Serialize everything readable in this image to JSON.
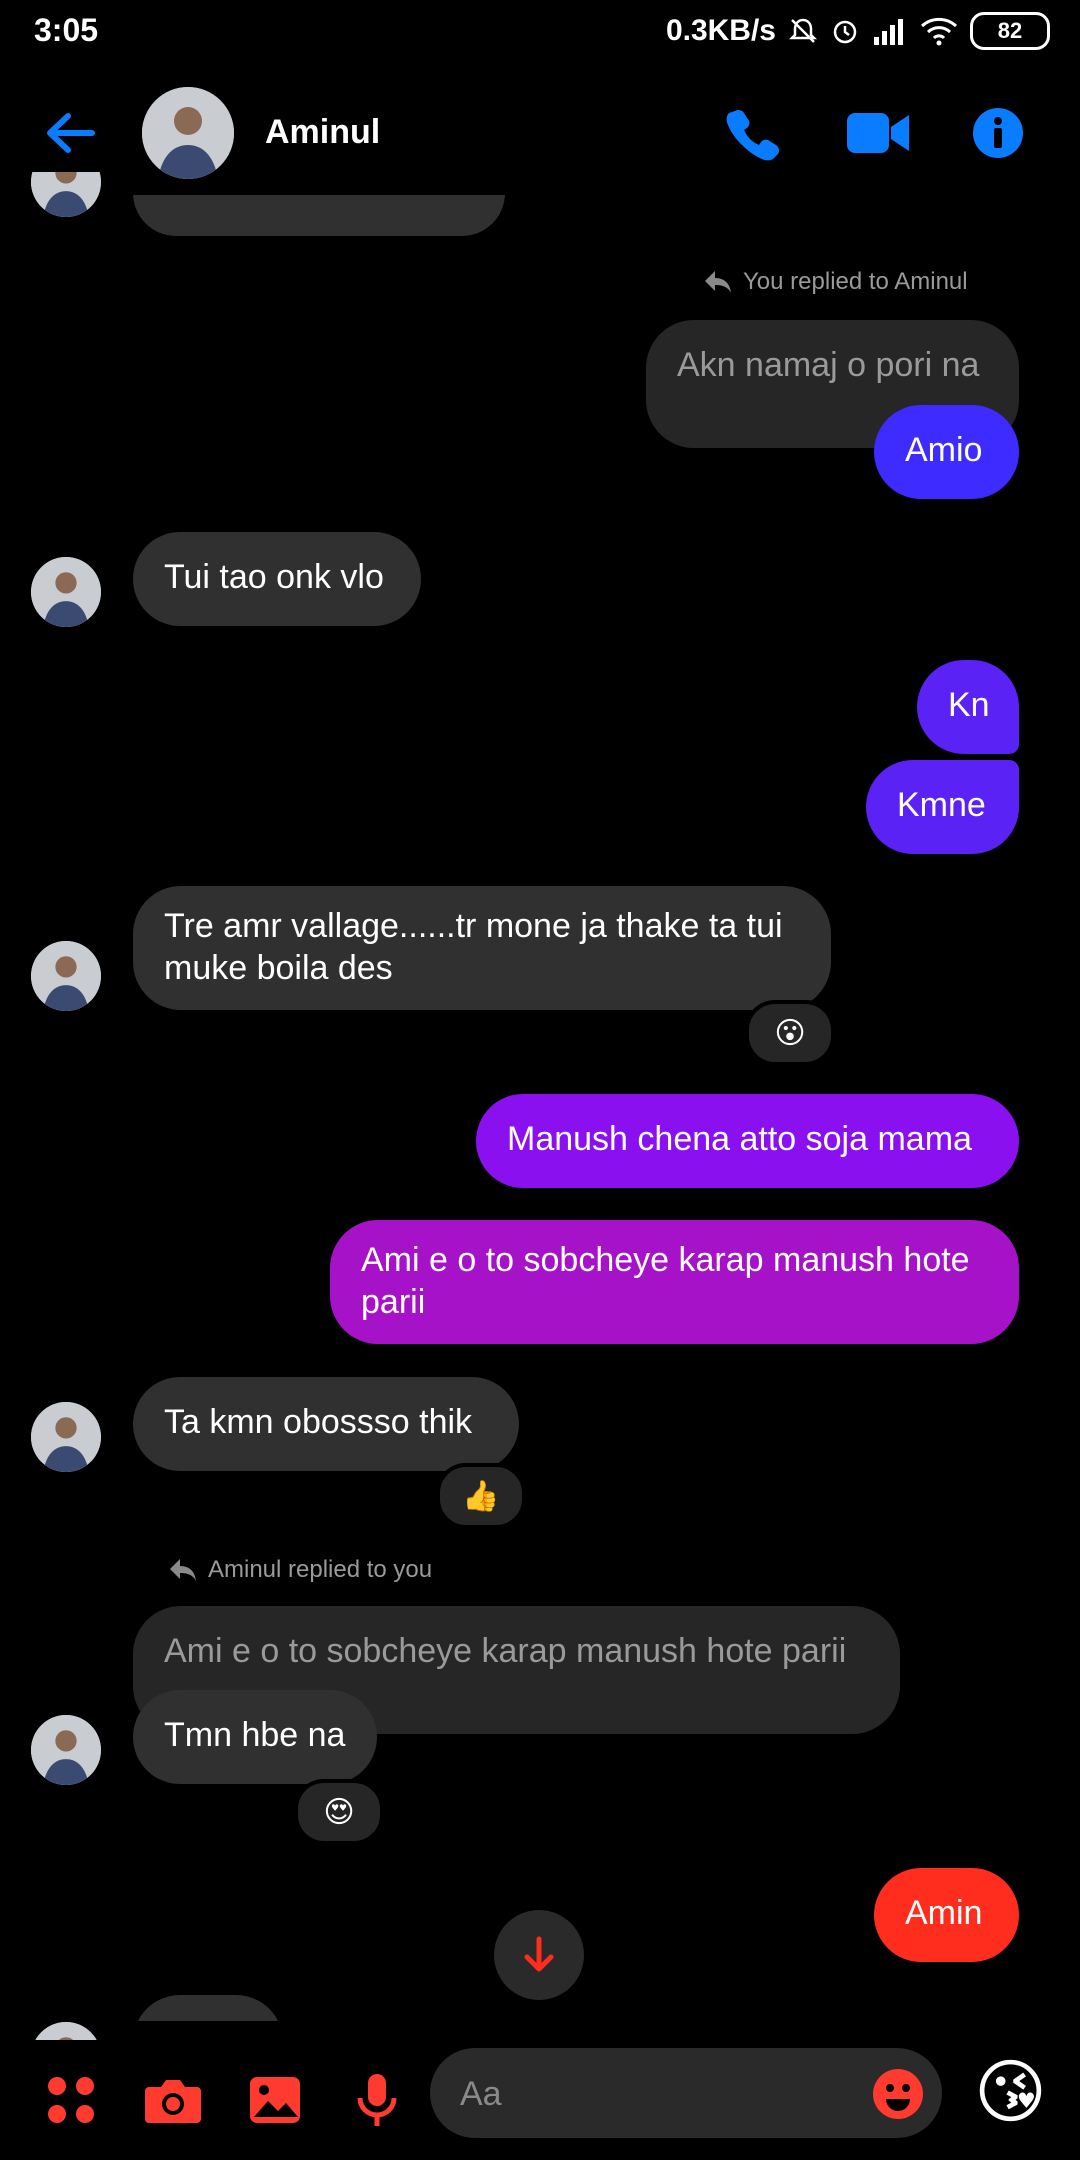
{
  "status_bar": {
    "time": "3:05",
    "speed": "0.3KB/s",
    "battery": "82"
  },
  "header": {
    "contact_name": "Aminul"
  },
  "messages": {
    "reply1_meta": "You replied to Aminul",
    "reply1_quote": "Akn namaj o pori na",
    "amio": "Amio",
    "tui_tao": "Tui tao onk vlo",
    "kn": "Kn",
    "kmne": "Kmne",
    "tre_amr": "Tre amr vallage......tr mone ja thake ta tui muke boila des",
    "reaction1": "😮",
    "manush": "Manush chena atto soja mama",
    "ami_e_o": "Ami e o to sobcheye karap manush hote parii",
    "ta_kmn": "Ta kmn obossso thik",
    "reaction2": "👍",
    "reply2_meta": "Aminul replied to you",
    "reply2_quote": "Ami e o to sobcheye karap manush hote parii",
    "tmn_hbe": "Tmn hbe na",
    "reaction3": "😍",
    "amin": "Amin"
  },
  "composer": {
    "placeholder": "Aa",
    "emoji": "😘"
  },
  "colors": {
    "accent_blue": "#0a7cff",
    "amio_bubble": "#3d2bff",
    "kn_bubble": "#5a22f5",
    "manush_bubble": "#8a10f0",
    "ami_e_o_bubble": "#a512c8",
    "amin_bubble": "#ff2d1e",
    "tool_red": "#ff3b30"
  },
  "icons": [
    "back-arrow-icon",
    "phone-icon",
    "video-icon",
    "info-icon",
    "reply-icon",
    "scroll-down-icon",
    "apps-icon",
    "camera-icon",
    "gallery-icon",
    "mic-icon",
    "emoji-icon"
  ]
}
